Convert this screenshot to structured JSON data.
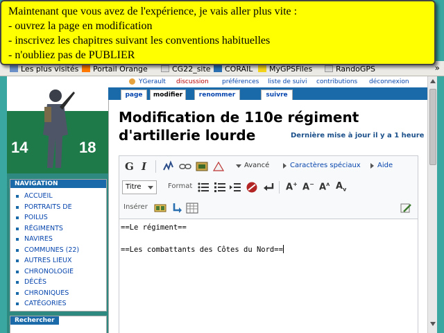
{
  "callout": {
    "lines": [
      "Maintenant que vous avez de l'expérience, je vais aller plus vite :",
      "- ouvrez la page en modification",
      "- inscrivez les chapitres suivant les conventions habituelles",
      "- n'oubliez pas de PUBLIER"
    ]
  },
  "bookmarks": {
    "items": [
      "Les plus visités",
      "Portail Orange",
      "CG22_site",
      "CORAIL",
      "MyGPSFiles",
      "RandoGPS"
    ],
    "more": "»"
  },
  "logo": {
    "year_start": "14",
    "year_end": "18"
  },
  "navigation": {
    "heading": "NAVIGATION",
    "items": [
      "ACCUEIL",
      "PORTRAITS DE",
      "POILUS",
      "RÉGIMENTS",
      "NAVIRES",
      "COMMUNES (22)",
      "AUTRES LIEUX",
      "CHRONOLOGIE",
      "DÉCÈS",
      "CHRONIQUES",
      "CATÉGORIES"
    ]
  },
  "search": {
    "heading": "Rechercher"
  },
  "userbar": {
    "user": "YGerault",
    "discussion": "discussion",
    "preferences": "préférences",
    "watchlist": "liste de suivi",
    "contributions": "contributions",
    "logout": "déconnexion"
  },
  "tabs": {
    "page": "page",
    "edit": "modifier",
    "rename": "renommer",
    "follow": "suivre"
  },
  "article": {
    "title_line1": "Modification de 110e régiment",
    "title_line2": "d'artillerie lourde",
    "updated": "Dernière mise à jour il y a 1 heure"
  },
  "editor": {
    "bold": "G",
    "italic": "I",
    "advanced": "Avancé",
    "special_chars": "Caractères spéciaux",
    "help": "Aide",
    "heading_select": "Titre",
    "format_label": "Format",
    "insert_label": "Insérer",
    "text_line1": "==Le régiment==",
    "text_line2": "==Les combattants des Côtes du Nord=="
  }
}
